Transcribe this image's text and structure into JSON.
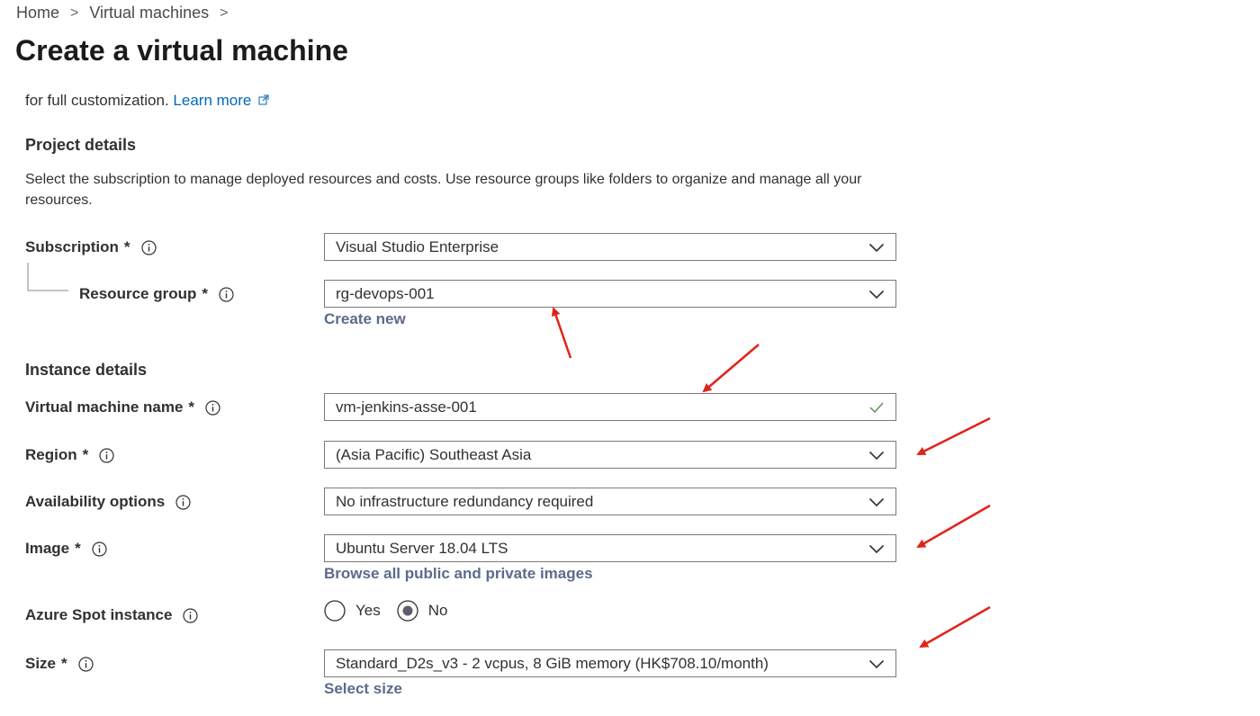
{
  "breadcrumb": {
    "items": [
      "Home",
      "Virtual machines"
    ]
  },
  "page_title": "Create a virtual machine",
  "clipped_intro": {
    "text": "for full customization.",
    "link": "Learn more"
  },
  "project_details": {
    "heading": "Project details",
    "description": "Select the subscription to manage deployed resources and costs. Use resource groups like folders to organize and manage all your resources.",
    "subscription": {
      "label": "Subscription",
      "required": "*",
      "value": "Visual Studio Enterprise"
    },
    "resource_group": {
      "label": "Resource group",
      "required": "*",
      "value": "rg-devops-001",
      "create_new": "Create new"
    }
  },
  "instance_details": {
    "heading": "Instance details",
    "vm_name": {
      "label": "Virtual machine name",
      "required": "*",
      "value": "vm-jenkins-asse-001"
    },
    "region": {
      "label": "Region",
      "required": "*",
      "value": "(Asia Pacific) Southeast Asia"
    },
    "availability": {
      "label": "Availability options",
      "value": "No infrastructure redundancy required"
    },
    "image": {
      "label": "Image",
      "required": "*",
      "value": "Ubuntu Server 18.04 LTS",
      "browse": "Browse all public and private images"
    },
    "spot": {
      "label": "Azure Spot instance",
      "options": [
        "Yes",
        "No"
      ],
      "selected": "No"
    },
    "size": {
      "label": "Size",
      "required": "*",
      "value": "Standard_D2s_v3 - 2 vcpus, 8 GiB memory (HK$708.10/month)",
      "select_size": "Select size"
    }
  },
  "colors": {
    "link": "#0067b8",
    "annotation_arrow": "#e0241b",
    "valid_check": "#5a8a5a"
  },
  "icons": [
    "chevron-right-icon",
    "external-link-icon",
    "info-icon",
    "chevron-down-icon",
    "checkmark-icon",
    "radio-selected-icon",
    "radio-unselected-icon"
  ]
}
